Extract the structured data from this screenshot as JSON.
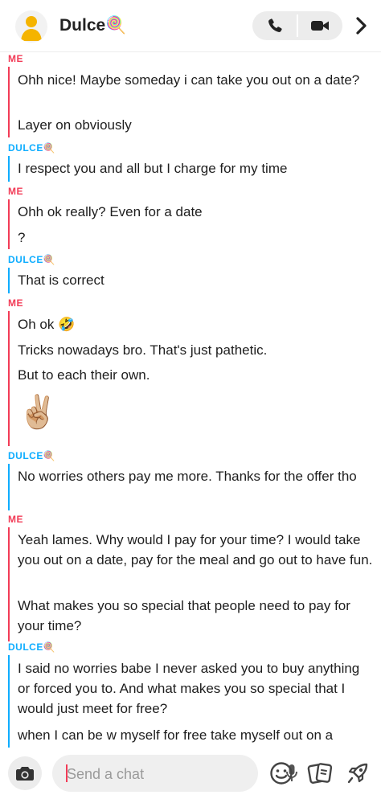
{
  "header": {
    "contact_name": "Dulce🍭",
    "icons": {
      "avatar": "bitmoji-avatar-icon",
      "call": "phone-icon",
      "video": "video-camera-icon",
      "more": "chevron-right-icon"
    }
  },
  "colors": {
    "me": "#f23c57",
    "dulce": "#0eadff"
  },
  "messages": [
    {
      "sender": "ME",
      "lines": [
        "Ohh nice! Maybe someday i can take you out on a date?",
        "Layer on obviously"
      ]
    },
    {
      "sender": "DULCE🍭",
      "lines": [
        "I respect you and all but I charge for my time"
      ]
    },
    {
      "sender": "ME",
      "lines": [
        "Ohh ok really? Even for a date",
        "?"
      ]
    },
    {
      "sender": "DULCE🍭",
      "lines": [
        "That is correct"
      ]
    },
    {
      "sender": "ME",
      "lines": [
        "Oh ok 🤣",
        "Tricks nowadays bro. That's just pathetic.",
        "But to each their own.",
        "✌🏼"
      ]
    },
    {
      "sender": "DULCE🍭",
      "lines": [
        "No worries others pay me more. Thanks for the offer tho"
      ]
    },
    {
      "sender": "ME",
      "lines": [
        "Yeah lames. Why would I pay for your time? I would take you out on a date, pay for the meal and go out to have fun.",
        "What makes you so special that people need to pay for your time?"
      ]
    },
    {
      "sender": "DULCE🍭",
      "lines": [
        "I said no worries babe I never asked you to buy anything or forced you to. And what makes you so special that I would just meet for free?",
        "when I can be w myself for free take myself out on a"
      ]
    }
  ],
  "composer": {
    "placeholder": "Send a chat",
    "value": "",
    "icons": {
      "camera": "camera-icon",
      "mic": "microphone-icon",
      "emoji": "smiley-icon",
      "stickers": "sticker-cards-icon",
      "games": "rocket-icon"
    }
  }
}
